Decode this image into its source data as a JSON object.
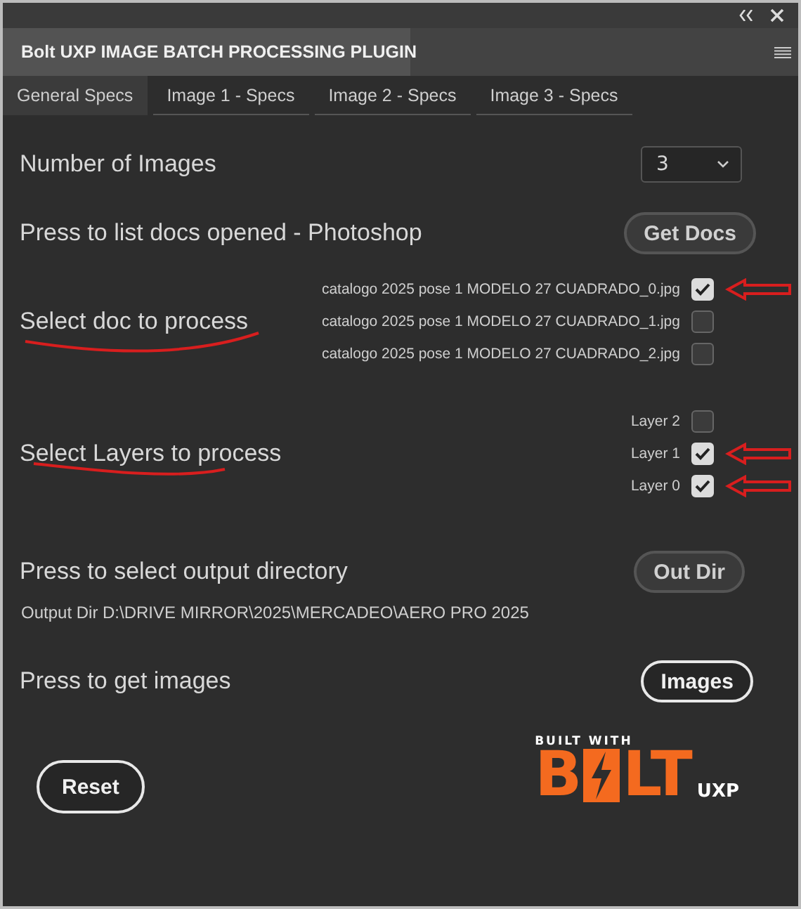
{
  "panel": {
    "title": "Bolt UXP IMAGE BATCH PROCESSING PLUGIN"
  },
  "tabs": [
    {
      "label": "General Specs",
      "selected": true
    },
    {
      "label": "Image 1 - Specs",
      "selected": false
    },
    {
      "label": "Image 2 - Specs",
      "selected": false
    },
    {
      "label": "Image 3 - Specs",
      "selected": false
    }
  ],
  "number_of_images": {
    "label": "Number of Images",
    "value": "3"
  },
  "list_docs": {
    "label": "Press to list docs opened - Photoshop",
    "button": "Get Docs"
  },
  "docs": {
    "label": "Select doc to process",
    "items": [
      {
        "name": "catalogo 2025 pose 1 MODELO 27 CUADRADO_0.jpg",
        "checked": true,
        "annotated": true
      },
      {
        "name": "catalogo 2025 pose 1 MODELO 27 CUADRADO_1.jpg",
        "checked": false,
        "annotated": false
      },
      {
        "name": "catalogo 2025 pose 1 MODELO 27 CUADRADO_2.jpg",
        "checked": false,
        "annotated": false
      }
    ]
  },
  "layers": {
    "label": "Select Layers to process",
    "items": [
      {
        "name": "Layer 2",
        "checked": false,
        "annotated": false
      },
      {
        "name": "Layer 1",
        "checked": true,
        "annotated": true
      },
      {
        "name": "Layer 0",
        "checked": true,
        "annotated": true
      }
    ]
  },
  "output": {
    "label": "Press to select output directory",
    "button": "Out Dir",
    "path": "Output Dir D:\\DRIVE MIRROR\\2025\\MERCADEO\\AERO PRO 2025"
  },
  "images": {
    "label": "Press to get images",
    "button": "Images"
  },
  "reset": {
    "button": "Reset"
  },
  "logo": {
    "tagline": "BUILT WITH",
    "left": "B",
    "right": "LT",
    "suffix": "UXP"
  }
}
